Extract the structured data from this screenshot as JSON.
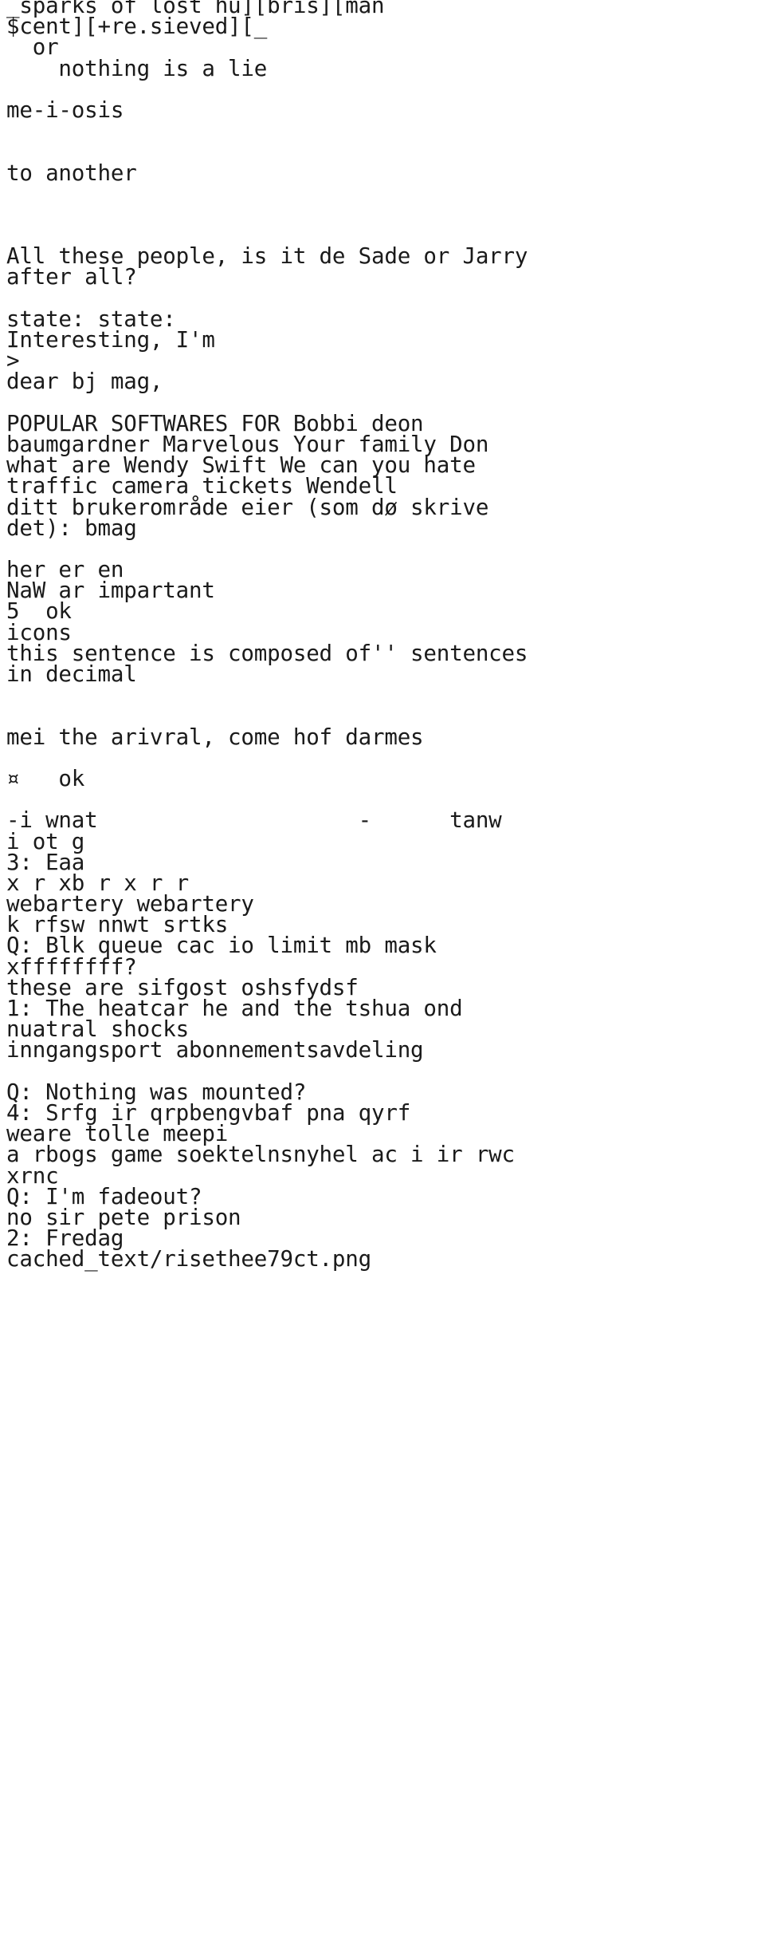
{
  "document": {
    "kind": "plain-text-page",
    "background_color": "#ffffff",
    "text_color": "#1a1a1a",
    "font_style": "monospace-typewriter",
    "footer_path": "cached_text/risethee79ct.png",
    "lines": [
      "_sparks of lost hu][bris][man",
      "$cent][+re.sieved][_",
      "  or",
      "    nothing is a lie",
      "",
      "me-i-osis",
      "",
      "",
      "to another",
      "",
      "",
      "",
      "All these people, is it de Sade or Jarry",
      "after all?",
      "",
      "state: state:",
      "Interesting, I'm",
      ">",
      "dear bj mag,",
      "",
      "POPULAR SOFTWARES FOR Bobbi deon",
      "baumgardner Marvelous Your family Don",
      "what are Wendy Swift We can you hate",
      "traffic camera tickets Wendell",
      "ditt brukerområde eier (som dø skrive",
      "det): bmag",
      "",
      "her er en",
      "NaW ar impartant",
      "5  ok",
      "icons",
      "this sentence is composed of'' sentences",
      "in decimal",
      "",
      "",
      "mei the arivral, come hof darmes",
      "",
      "¤   ok",
      "",
      "-i wnat                    -      tanw",
      "i ot g",
      "3: Eaa",
      "x r xb r x r r",
      "webartery webartery",
      "k rfsw nnwt srtks",
      "Q: Blk queue cac io limit mb mask",
      "xffffffff?",
      "these are sifgost oshsfydsf",
      "1: The heatcar he and the tshua ond",
      "nuatral shocks",
      "inngangsport abonnementsavdeling",
      "",
      "Q: Nothing was mounted?",
      "4: Srfg ir qrpbengvbaf pna qyrf",
      "weare tolle meepi",
      "a rbogs game soektelnsnyhel ac i ir rwc",
      "xrnc",
      "Q: I'm fadeout?",
      "no sir pete prison",
      "2: Fredag",
      "cached_text/risethee79ct.png"
    ]
  }
}
